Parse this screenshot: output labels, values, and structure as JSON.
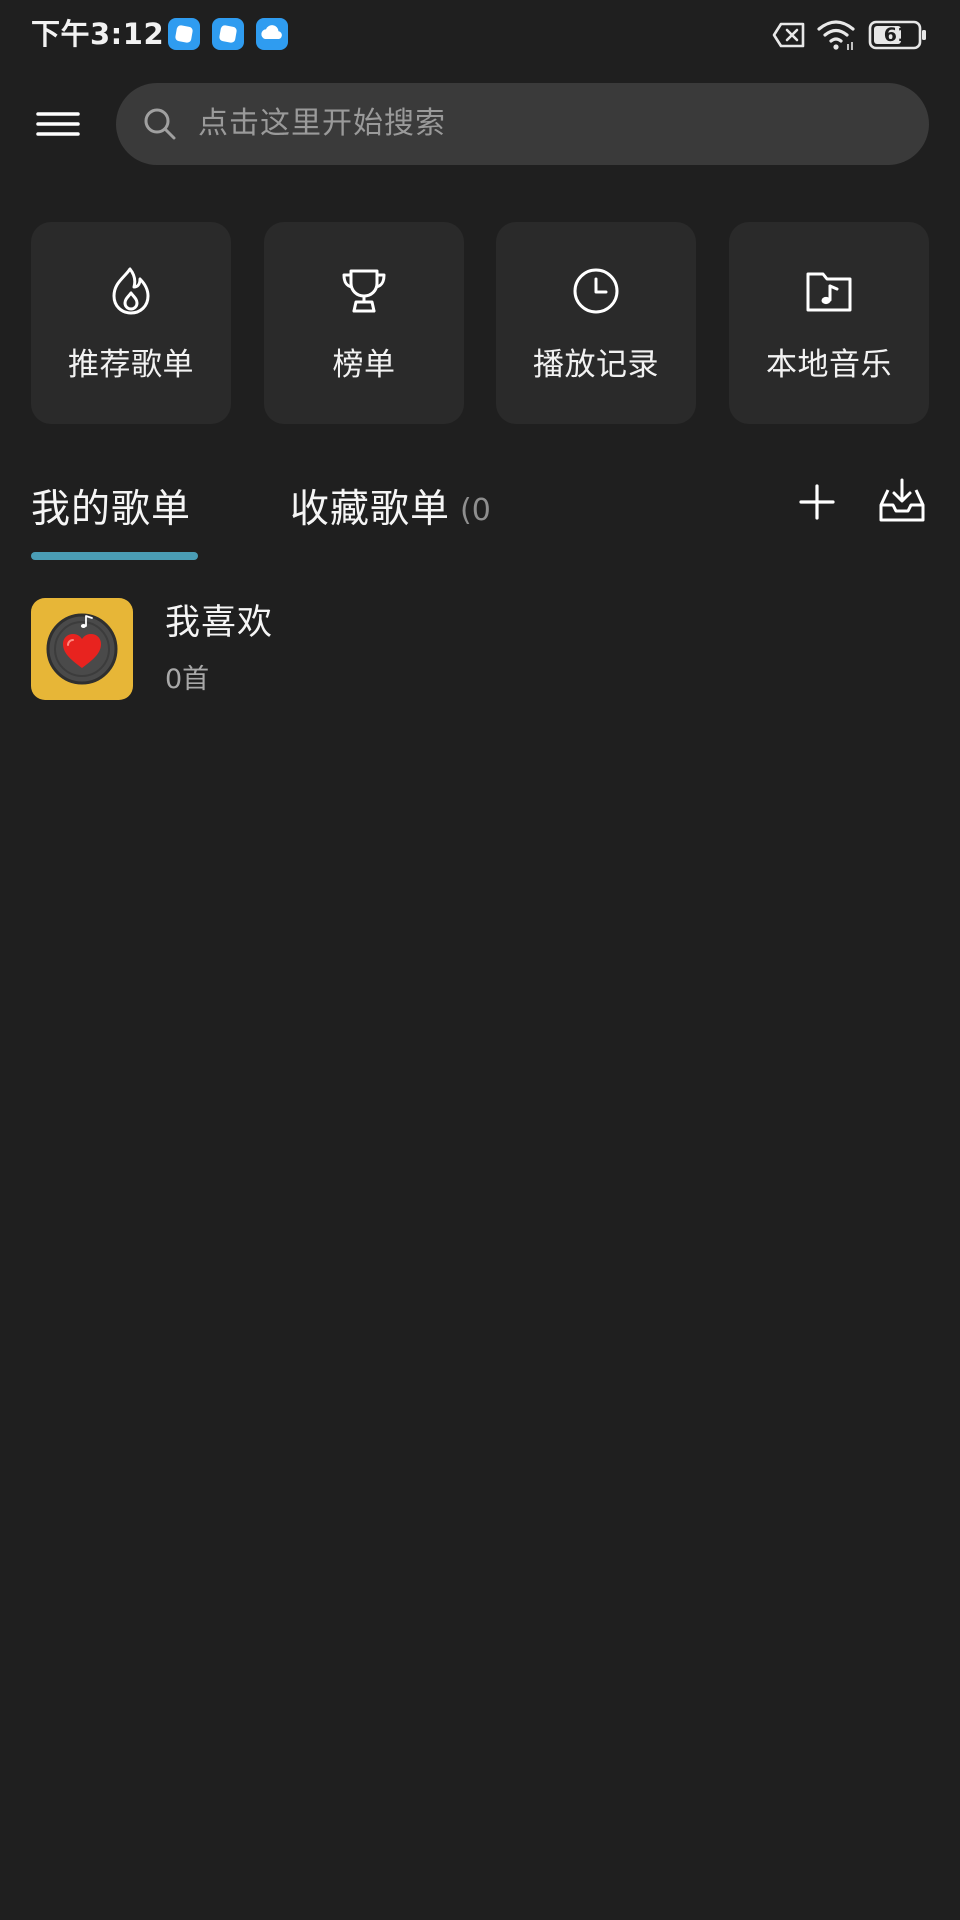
{
  "status_bar": {
    "time": "下午3:12",
    "battery": "61"
  },
  "search": {
    "placeholder": "点击这里开始搜索"
  },
  "quick_actions": [
    {
      "label": "推荐歌单",
      "icon": "flame-icon"
    },
    {
      "label": "榜单",
      "icon": "trophy-icon"
    },
    {
      "label": "播放记录",
      "icon": "clock-icon"
    },
    {
      "label": "本地音乐",
      "icon": "music-folder-icon"
    }
  ],
  "tabs": {
    "my_playlists": "我的歌单",
    "collected_playlists": "收藏歌单",
    "collected_count": "(0"
  },
  "playlists": [
    {
      "title": "我喜欢",
      "count": "0首"
    }
  ],
  "colors": {
    "background": "#1f1f1f",
    "card": "#2a2a2a",
    "search_bg": "#3a3a3a",
    "tab_indicator": "#4a9db5",
    "cover_bg": "#e7b637",
    "heart": "#e8231f"
  }
}
